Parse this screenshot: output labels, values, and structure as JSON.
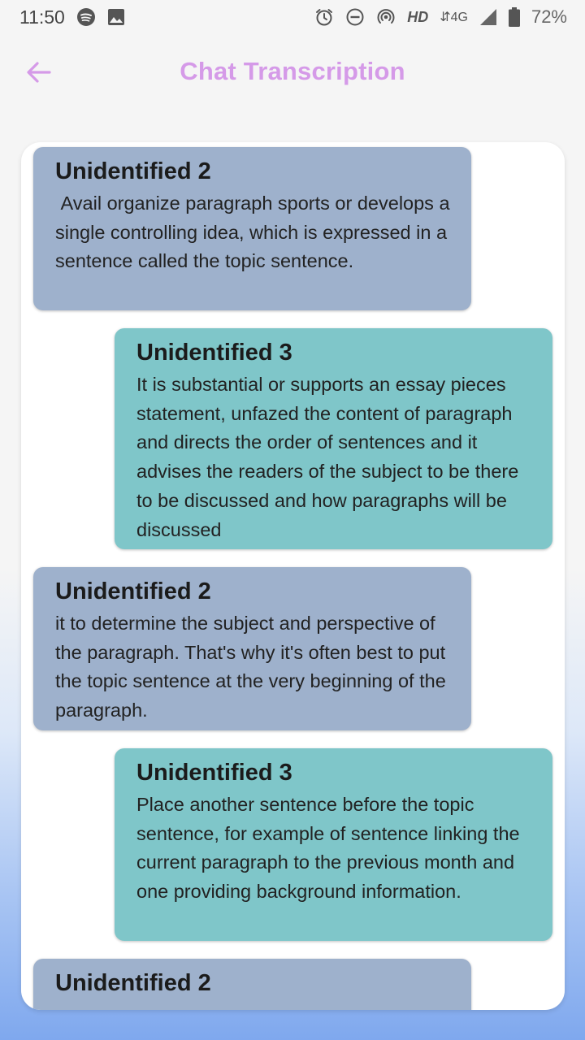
{
  "status_bar": {
    "time": "11:50",
    "hd_label": "HD",
    "network_label": "4G",
    "battery_percent": "72%"
  },
  "header": {
    "title": "Chat Transcription",
    "back_icon": "arrow-left-icon"
  },
  "colors": {
    "accent": "#d59ae8",
    "speaker_2_bubble": "#9eb1cc",
    "speaker_3_bubble": "#7fc6c9"
  },
  "messages": [
    {
      "speaker": "Unidentified 2",
      "text": " Avail organize paragraph sports or develops a single controlling idea, which is expressed in a sentence called the topic sentence."
    },
    {
      "speaker": "Unidentified 3",
      "text": "It is substantial or supports an essay pieces statement, unfazed the content of paragraph and directs the order of sentences and it advises the readers of the subject to be there to be discussed and how paragraphs will be discussed"
    },
    {
      "speaker": "Unidentified 2",
      "text": "it to determine the subject and perspective of the paragraph. That's why it's often best to put the topic sentence at the very beginning of the paragraph."
    },
    {
      "speaker": "Unidentified 3",
      "text": "Place another sentence before the topic sentence, for example of sentence linking the current paragraph to the previous month and one providing background information."
    },
    {
      "speaker": "Unidentified 2",
      "text": ""
    }
  ]
}
